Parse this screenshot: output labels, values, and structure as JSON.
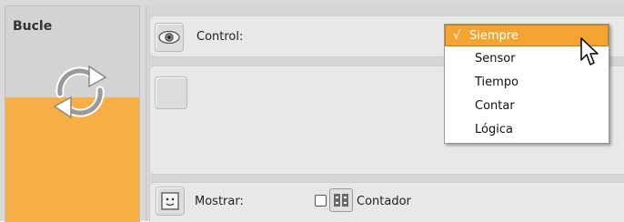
{
  "block": {
    "title": "Bucle",
    "icon": "loop-arrows-icon"
  },
  "control": {
    "label": "Control:",
    "icon": "eye-icon",
    "selected": "Siempre",
    "check_mark": "√",
    "options": [
      "Siempre",
      "Sensor",
      "Tiempo",
      "Contar",
      "Lógica"
    ]
  },
  "show": {
    "label": "Mostrar:",
    "icon": "face-icon",
    "counter_label": "Contador",
    "counter_checked": false,
    "counter_icon": "counter-icon"
  },
  "colors": {
    "accent_orange": "#f6ae45",
    "selected_item": "#f4a430"
  }
}
